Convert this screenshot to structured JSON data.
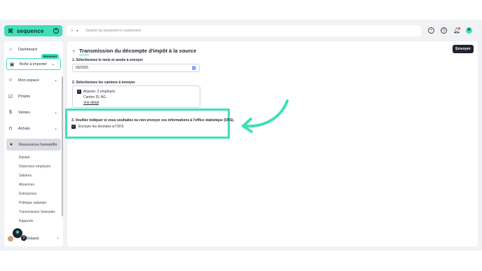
{
  "brand": {
    "mark": "⌘",
    "name": "sequence"
  },
  "search": {
    "placeholder": "Search by keyword in customers"
  },
  "top_icons": [
    "plus-circle-icon",
    "clock-icon",
    "bell-icon",
    "user-avatar-icon"
  ],
  "sidebar": {
    "items": [
      {
        "label": "Dashboard",
        "icon": "home-icon"
      },
      {
        "label": "Boîte à importer",
        "icon": "inbox-icon",
        "badge": "Nouveau"
      },
      {
        "label": "Mon espace",
        "icon": "person-icon"
      },
      {
        "label": "Projets",
        "icon": "check-square-icon"
      },
      {
        "label": "Ventes",
        "icon": "money-bag-icon"
      },
      {
        "label": "Achats",
        "icon": "shopping-bag-icon"
      },
      {
        "label": "Ressources humaines",
        "icon": "people-icon"
      }
    ],
    "hr_subitems": [
      "Équipe",
      "Dépenses employés",
      "Salaires",
      "Absences",
      "Entreprises",
      "Politique salariale",
      "Transmission Swissdec",
      "Rapports"
    ],
    "user_name": "Roland",
    "fab_badge": "3"
  },
  "main": {
    "title": "Transmission du décompte d'impôt à la source",
    "send_label": "Envoyer",
    "section1_label": "1. Sélectionnez le mois et année à envoyer",
    "month_value": "03/2025",
    "section2_label": "2. Sélectionnez les cantons à envoyer",
    "canton": {
      "name": "Argovie: 2 employés",
      "code": "Canton IS: AG",
      "link": "Voir détail",
      "checked": true
    },
    "section3_label": "3. Veuillez indiquer si vous souhaitez ou non envoyer ces informations à l'office statistique (OFS).",
    "ofs_label": "Envoyer les données à l'OFS",
    "ofs_checked": true
  },
  "colors": {
    "accent": "#3de0b9",
    "dark": "#1f2330",
    "bg": "#f1f2f4"
  }
}
